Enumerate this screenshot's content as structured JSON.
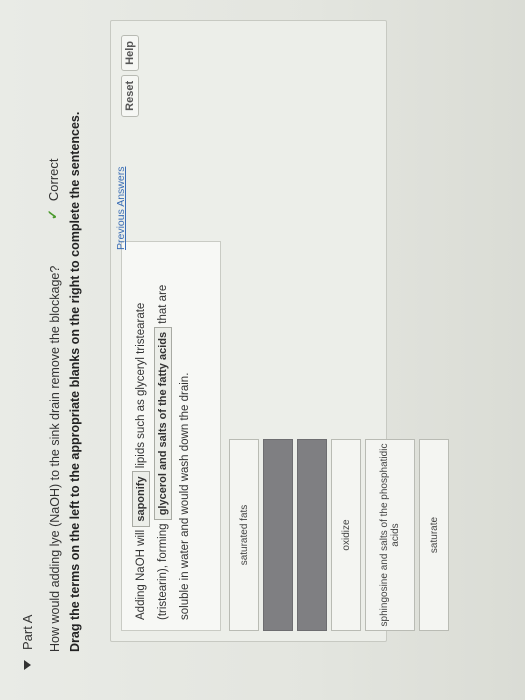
{
  "part": {
    "label": "Part A"
  },
  "question": "How would adding lye (NaOH) to the sink drain remove the blockage?",
  "instructions": "Drag the terms on the left to the appropriate blanks on the right to complete the sentences.",
  "buttons": {
    "reset": "Reset",
    "help": "Help"
  },
  "terms": {
    "t1": "saturated fats",
    "t2": "oxidize",
    "t3": "sphingosine and salts of the phosphatidic acids",
    "t4": "saturate"
  },
  "sentence": {
    "part1": "Adding NaOH will",
    "blank1": "saponify",
    "part2": "lipids such as glyceryl tristearate (tristearin), forming",
    "blank2": "glycerol and salts of the fatty acids",
    "part3": "that are soluble in water and would wash down the drain."
  },
  "links": {
    "previous_answers": "Previous Answers"
  },
  "status": {
    "correct": "Correct"
  }
}
